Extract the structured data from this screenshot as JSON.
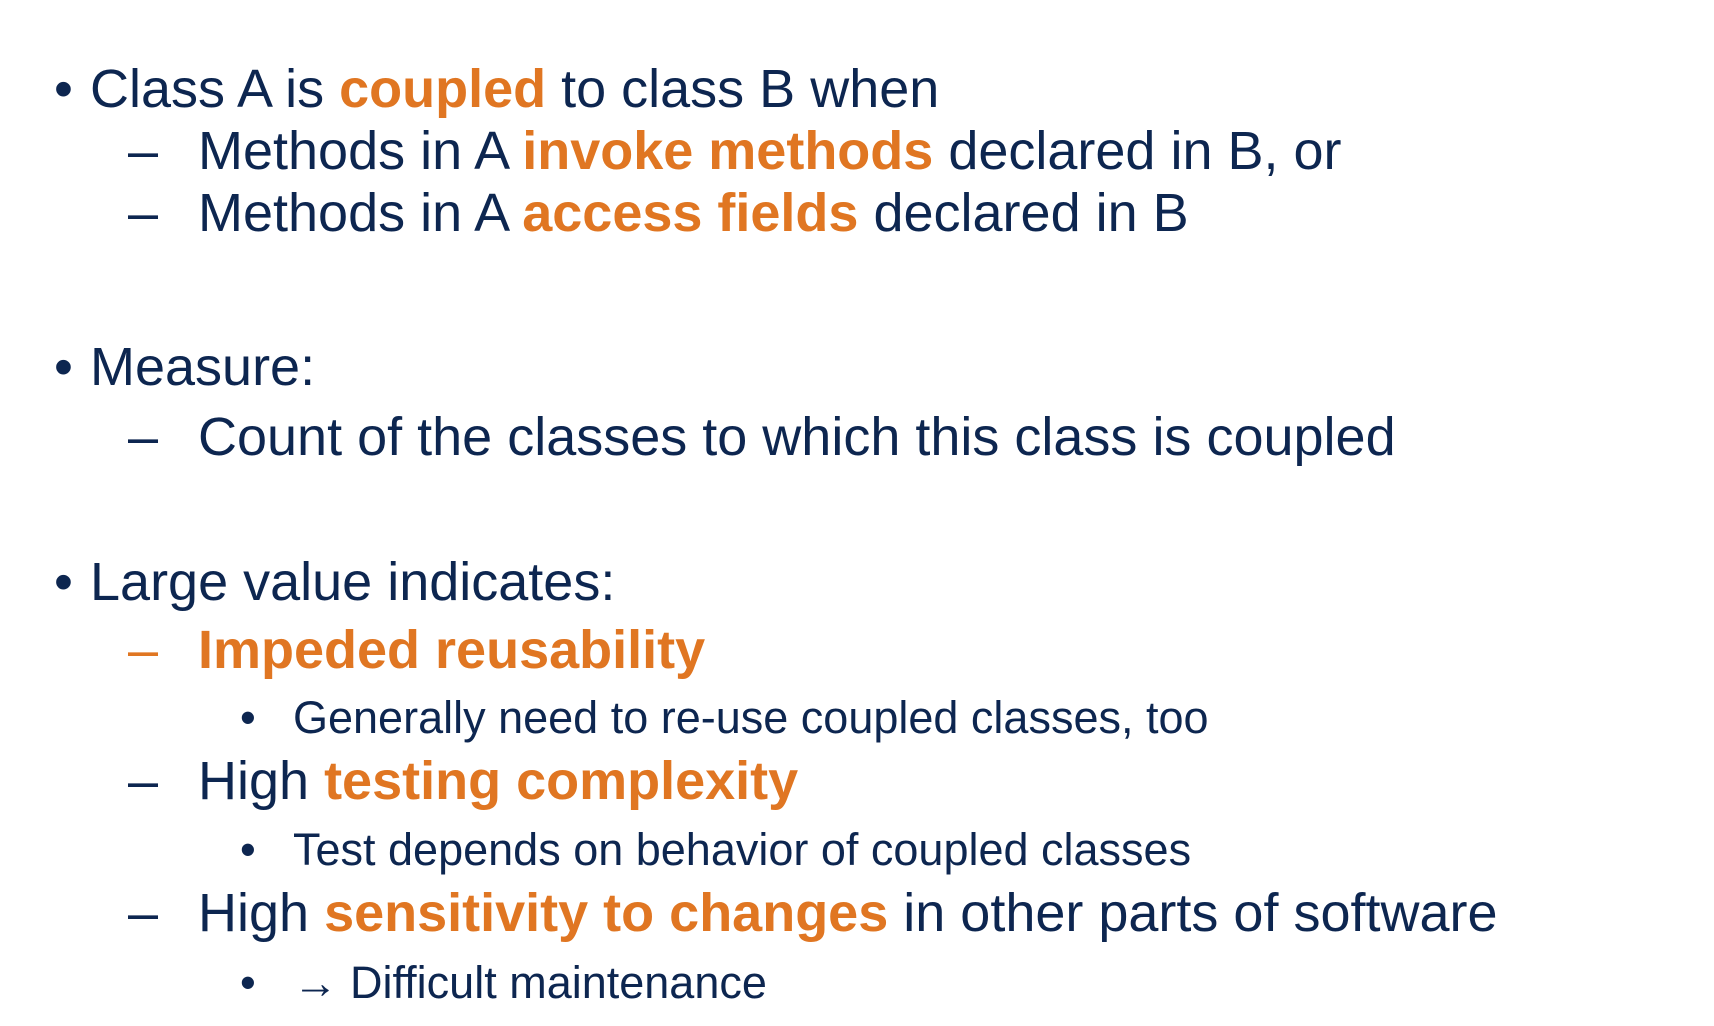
{
  "bullets": [
    {
      "marker": "•",
      "pre": "Class A is ",
      "highlight": "coupled",
      "post": " to class B when",
      "children": [
        {
          "marker": "–",
          "pre": "Methods in A ",
          "highlight": "invoke methods",
          "post": " declared in B, or"
        },
        {
          "marker": "–",
          "pre": "Methods in A ",
          "highlight": "access fields",
          "post": " declared in B"
        }
      ]
    },
    {
      "marker": "•",
      "text": "Measure:",
      "children": [
        {
          "marker": "–",
          "text": "Count of the classes to which this class is coupled"
        }
      ]
    },
    {
      "marker": "•",
      "text": "Large value indicates:",
      "children": [
        {
          "marker": "–",
          "highlight": "Impeded reusability",
          "children": [
            {
              "marker": "•",
              "text": "Generally need to re-use coupled classes, too"
            }
          ]
        },
        {
          "marker": "–",
          "pre": "High ",
          "highlight": "testing complexity",
          "children": [
            {
              "marker": "•",
              "text": "Test depends on behavior of coupled classes"
            }
          ]
        },
        {
          "marker": "–",
          "pre": "High ",
          "highlight": "sensitivity to changes",
          "post": " in other parts of software",
          "children": [
            {
              "marker": "•",
              "arrow": "→",
              "text": "Difficult maintenance"
            }
          ]
        }
      ]
    }
  ],
  "colors": {
    "text": "#0d2650",
    "highlight": "#e07622",
    "background": "#ffffff"
  }
}
